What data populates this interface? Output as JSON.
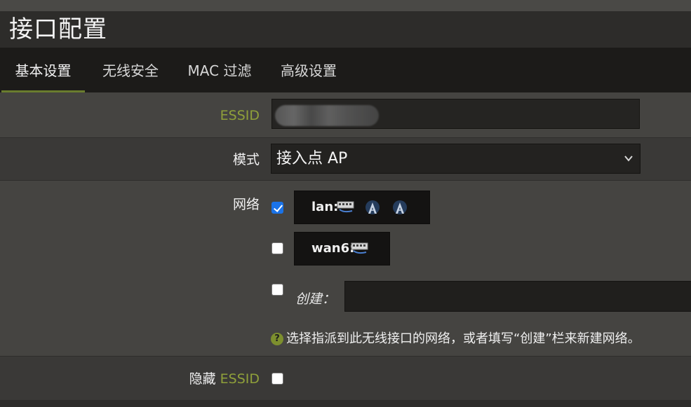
{
  "page": {
    "title": "接口配置"
  },
  "tabs": [
    {
      "label": "基本设置",
      "active": true
    },
    {
      "label": "无线安全",
      "active": false
    },
    {
      "label": "MAC 过滤",
      "active": false
    },
    {
      "label": "高级设置",
      "active": false
    }
  ],
  "form": {
    "essid": {
      "label": "ESSID",
      "value_obscured": true
    },
    "mode": {
      "label": "模式",
      "selected": "接入点 AP"
    },
    "network": {
      "label": "网络",
      "options": [
        {
          "name": "lan:",
          "checked": true,
          "icons": [
            "wired-network-icon",
            "wireless-icon",
            "wireless-icon"
          ]
        },
        {
          "name": "wan6:",
          "checked": false,
          "icons": [
            "wired-network-icon"
          ]
        }
      ],
      "create": {
        "label": "创建：",
        "checked": false,
        "value": ""
      },
      "help_text": "选择指派到此无线接口的网络，或者填写“创建”栏来新建网络。"
    },
    "hide_essid": {
      "label_prefix": "隐藏",
      "label_accent": "ESSID",
      "checked": false
    }
  },
  "colors": {
    "accent": "#8fa03a",
    "tab_underline": "#6a7d2e",
    "checkbox_checked": "#1a73e8"
  }
}
